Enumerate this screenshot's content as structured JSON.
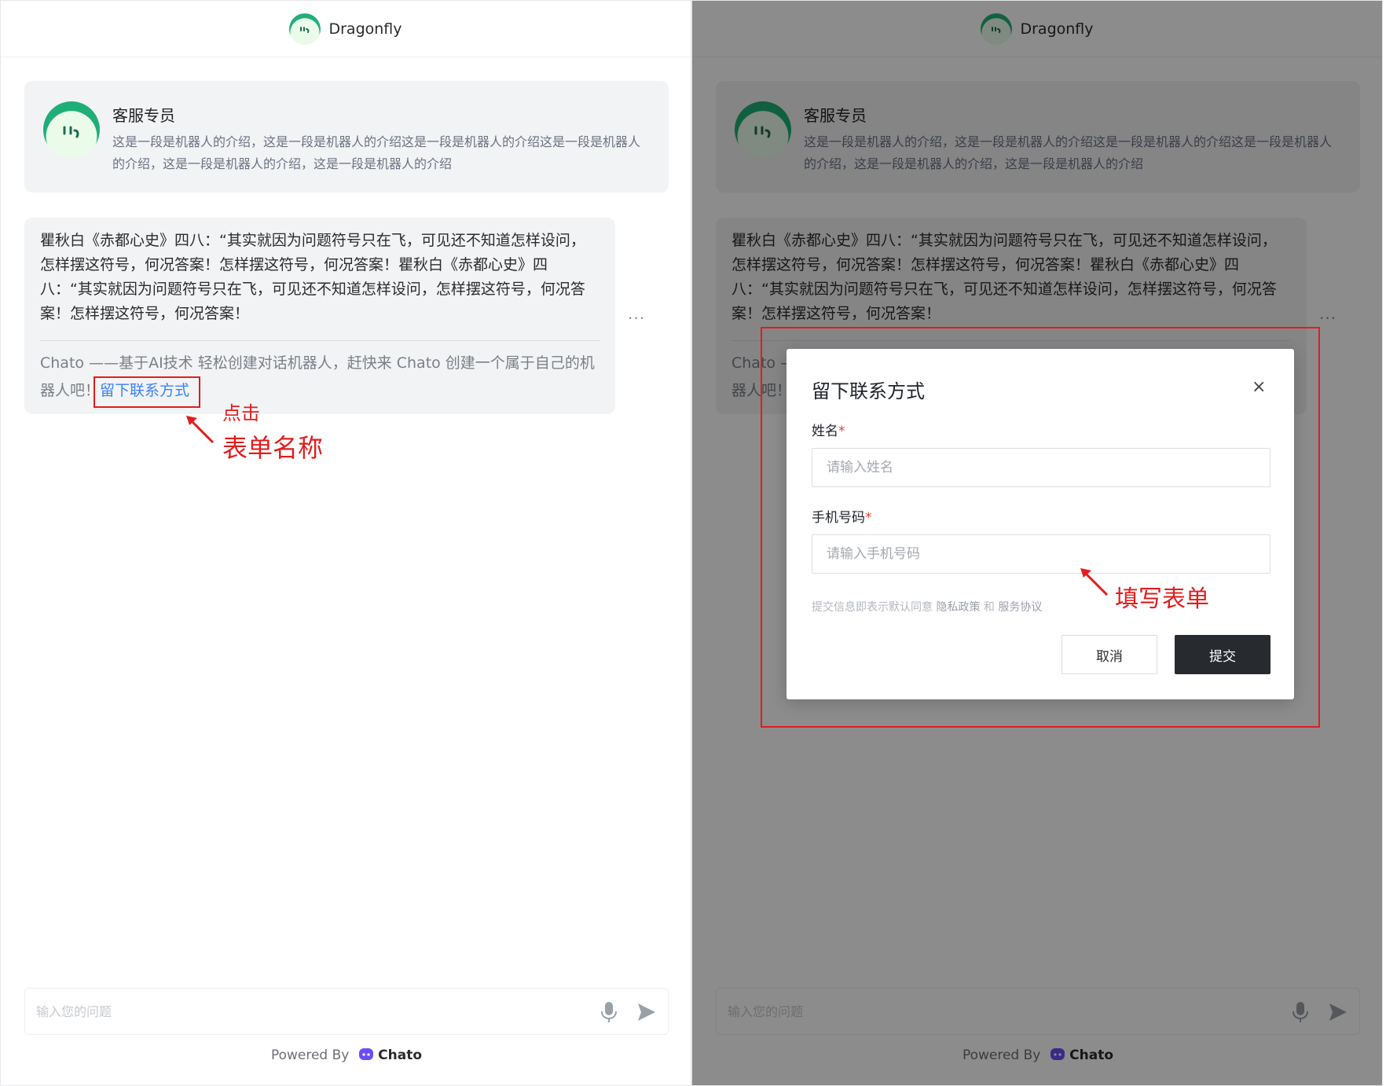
{
  "app": {
    "brand": "Dragonfly"
  },
  "bot": {
    "name": "客服专员",
    "intro": "这是一段是机器人的介绍，这是一段是机器人的介绍这是一段是机器人的介绍这是一段是机器人的介绍，这是一段是机器人的介绍，这是一段是机器人的介绍"
  },
  "message": {
    "text": "瞿秋白《赤都心史》四八：“其实就因为问题符号只在飞，可见还不知道怎样设问，怎样摆这符号，何况答案！怎样摆这符号，何况答案！瞿秋白《赤都心史》四八：“其实就因为问题符号只在飞，可见还不知道怎样设问，怎样摆这符号，何况答案！怎样摆这符号，何况答案！",
    "footer_text": "Chato ——基于AI技术 轻松创建对话机器人，赶快来 Chato 创建一个属于自己的机器人吧！",
    "form_link": "留下联系方式",
    "more": "···"
  },
  "input": {
    "placeholder": "输入您的问题"
  },
  "footer": {
    "powered_by": "Powered By",
    "chato": "Chato"
  },
  "modal": {
    "title": "留下联系方式",
    "close": "×",
    "name_label": "姓名",
    "name_placeholder": "请输入姓名",
    "phone_label": "手机号码",
    "phone_placeholder": "请输入手机号码",
    "required_mark": "*",
    "agree_prefix": "提交信息即表示默认同意",
    "privacy": "隐私政策",
    "and": "和",
    "service": "服务协议",
    "cancel": "取消",
    "submit": "提交"
  },
  "annotations": {
    "click": "点击",
    "form_name": "表单名称",
    "fill_form": "填写表单"
  },
  "colors": {
    "accent_green": "#1fae77",
    "link_blue": "#3b82f6",
    "annotation_red": "#e11d1d",
    "submit_dark": "#272a2f"
  }
}
